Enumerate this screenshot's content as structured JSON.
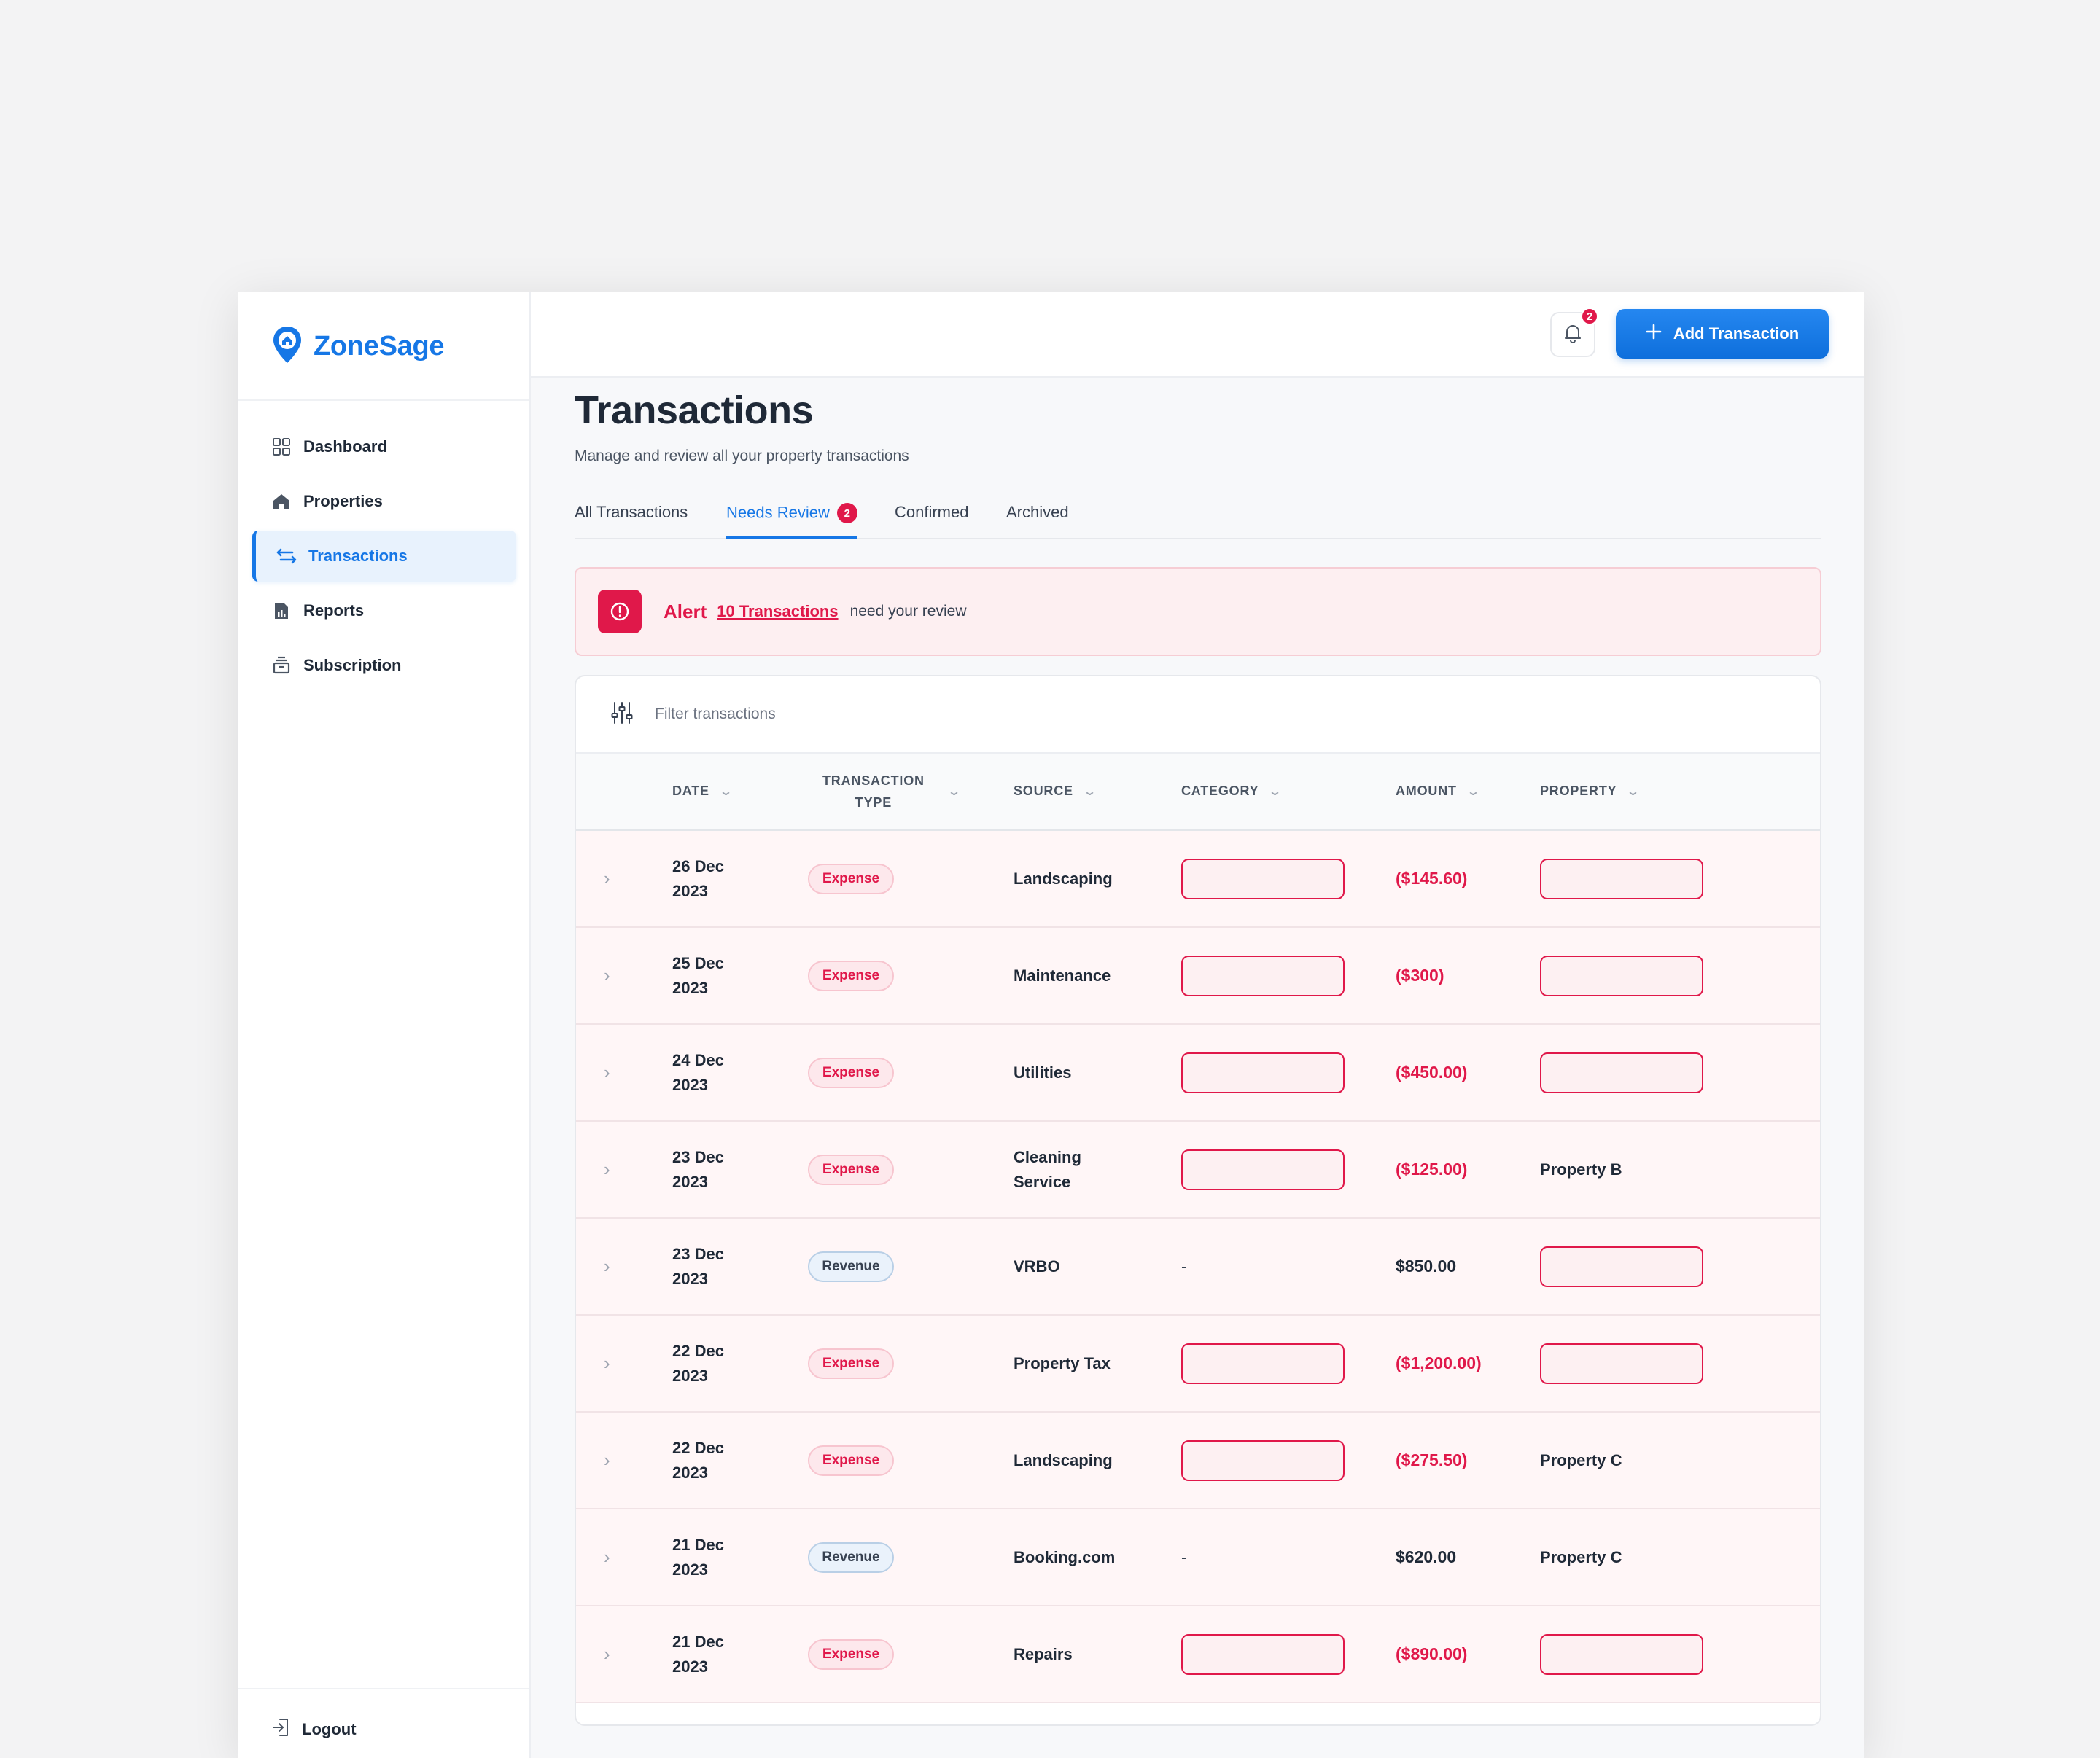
{
  "app": {
    "name": "ZoneSage"
  },
  "sidebar": {
    "items": [
      {
        "label": "Dashboard",
        "icon": "grid-icon"
      },
      {
        "label": "Properties",
        "icon": "home-icon"
      },
      {
        "label": "Transactions",
        "icon": "transfer-icon",
        "active": true
      },
      {
        "label": "Reports",
        "icon": "report-icon"
      },
      {
        "label": "Subscription",
        "icon": "package-icon"
      }
    ],
    "logout_label": "Logout"
  },
  "topbar": {
    "notification_count": "2",
    "add_button_label": "Add Transaction"
  },
  "page": {
    "title": "Transactions",
    "subtitle": "Manage and review all your property transactions"
  },
  "tabs": [
    {
      "label": "All Transactions"
    },
    {
      "label": "Needs Review",
      "badge": "2",
      "active": true
    },
    {
      "label": "Confirmed"
    },
    {
      "label": "Archived"
    }
  ],
  "alert": {
    "title": "Alert",
    "link_text": "10 Transactions",
    "message": "need your review"
  },
  "filter": {
    "placeholder": "Filter transactions"
  },
  "table": {
    "columns": {
      "date": "DATE",
      "type_line1": "TRANSACTION",
      "type_line2": "TYPE",
      "source": "SOURCE",
      "category": "CATEGORY",
      "amount": "AMOUNT",
      "property": "PROPERTY"
    },
    "rows": [
      {
        "date1": "26 Dec",
        "date2": "2023",
        "type": "Expense",
        "source1": "Landscaping",
        "source2": "",
        "category": "",
        "amount": "($145.60)",
        "property": ""
      },
      {
        "date1": "25 Dec",
        "date2": "2023",
        "type": "Expense",
        "source1": "Maintenance",
        "source2": "",
        "category": "",
        "amount": "($300)",
        "property": ""
      },
      {
        "date1": "24 Dec",
        "date2": "2023",
        "type": "Expense",
        "source1": "Utilities",
        "source2": "",
        "category": "",
        "amount": "($450.00)",
        "property": ""
      },
      {
        "date1": "23 Dec",
        "date2": "2023",
        "type": "Expense",
        "source1": "Cleaning",
        "source2": "Service",
        "category": "",
        "amount": "($125.00)",
        "property": "Property B"
      },
      {
        "date1": "23 Dec",
        "date2": "2023",
        "type": "Revenue",
        "source1": "VRBO",
        "source2": "",
        "category": "-",
        "amount": "$850.00",
        "property": ""
      },
      {
        "date1": "22 Dec",
        "date2": "2023",
        "type": "Expense",
        "source1": "Property Tax",
        "source2": "",
        "category": "",
        "amount": "($1,200.00)",
        "property": ""
      },
      {
        "date1": "22 Dec",
        "date2": "2023",
        "type": "Expense",
        "source1": "Landscaping",
        "source2": "",
        "category": "",
        "amount": "($275.50)",
        "property": "Property C"
      },
      {
        "date1": "21 Dec",
        "date2": "2023",
        "type": "Revenue",
        "source1": "Booking.com",
        "source2": "",
        "category": "-",
        "amount": "$620.00",
        "property": "Property C"
      },
      {
        "date1": "21 Dec",
        "date2": "2023",
        "type": "Expense",
        "source1": "Repairs",
        "source2": "",
        "category": "",
        "amount": "($890.00)",
        "property": ""
      }
    ]
  },
  "colors": {
    "brand": "#1677e6",
    "alert": "#e0184a",
    "row_bg": "#fff6f7"
  }
}
